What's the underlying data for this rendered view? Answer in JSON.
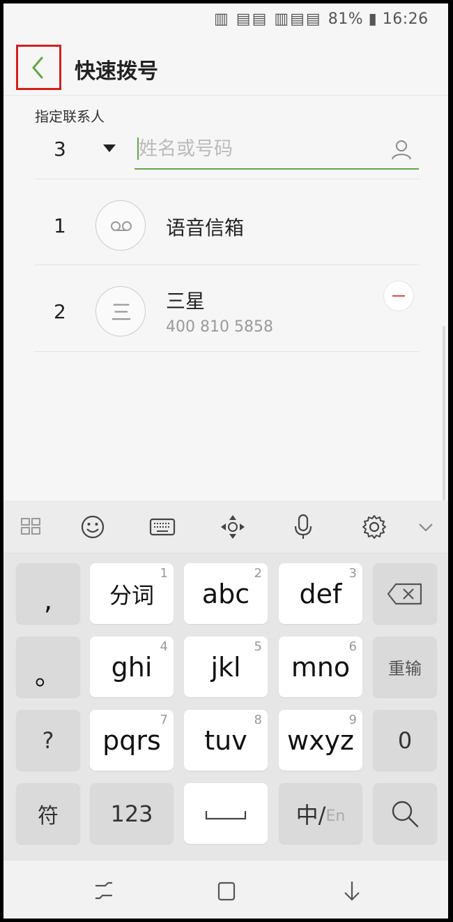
{
  "status_bar": {
    "text": "窯彐 彐彐彐 81% ▮ 16:26",
    "battery": "81%",
    "time": "16:26"
  },
  "header": {
    "title": "快速拨号",
    "back_icon": "chevron-left-icon"
  },
  "assign": {
    "label": "指定联系人",
    "slot": "3",
    "search_placeholder": "姓名或号码",
    "search_value": ""
  },
  "entries": [
    {
      "number": "1",
      "name": "语音信箱",
      "icon": "voicemail-icon"
    },
    {
      "number": "2",
      "name": "三星",
      "phone": "400 810 5858",
      "icon": "contact-initial-icon",
      "initial": "三"
    }
  ],
  "keyboard": {
    "toolbar_icons": [
      "grid-icon",
      "emoji-icon",
      "keyboard-icon",
      "cursor-move-icon",
      "microphone-icon",
      "settings-icon",
      "collapse-icon"
    ],
    "rows": [
      [
        {
          "label": ",",
          "hint": ""
        },
        {
          "label": "分词",
          "hint": "1"
        },
        {
          "label": "abc",
          "hint": "2"
        },
        {
          "label": "def",
          "hint": "3"
        },
        {
          "label": "",
          "hint": "",
          "icon": "backspace-icon"
        }
      ],
      [
        {
          "label": "。",
          "hint": ""
        },
        {
          "label": "ghi",
          "hint": "4"
        },
        {
          "label": "jkl",
          "hint": "5"
        },
        {
          "label": "mno",
          "hint": "6"
        },
        {
          "label": "重输",
          "hint": ""
        }
      ],
      [
        {
          "label": "?",
          "hint": ""
        },
        {
          "label": "pqrs",
          "hint": "7"
        },
        {
          "label": "tuv",
          "hint": "8"
        },
        {
          "label": "wxyz",
          "hint": "9"
        },
        {
          "label": "0",
          "hint": ""
        }
      ],
      [
        {
          "label": "符",
          "hint": ""
        },
        {
          "label": "123",
          "hint": ""
        },
        {
          "label": "",
          "hint": "",
          "icon": "space-icon"
        },
        {
          "label": "中/",
          "sub": "En",
          "hint": ""
        },
        {
          "label": "",
          "hint": "",
          "icon": "search-icon"
        }
      ]
    ]
  },
  "nav_bar": {
    "icons": [
      "recents-icon",
      "home-icon",
      "back-icon"
    ]
  },
  "colors": {
    "accent": "#5fa845",
    "highlight": "#d21f1f",
    "remove": "#e04a4a"
  }
}
